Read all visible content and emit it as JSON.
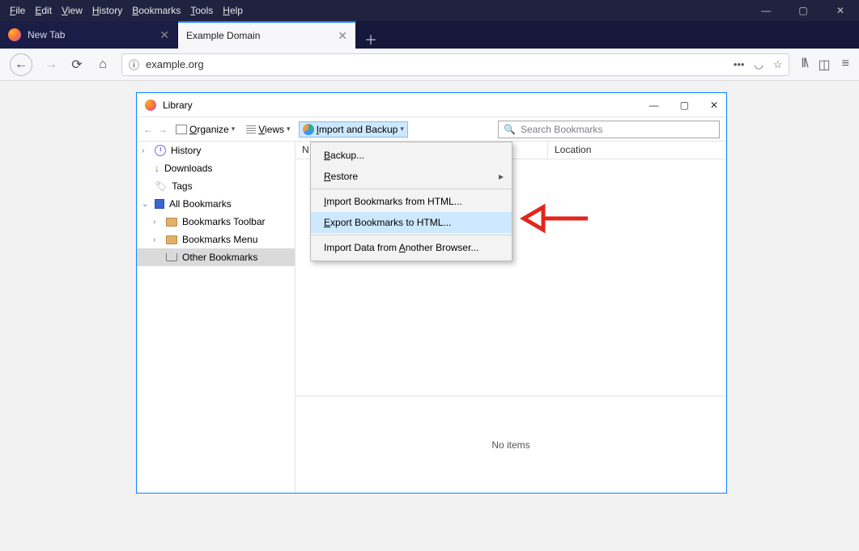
{
  "menubar": [
    "File",
    "Edit",
    "View",
    "History",
    "Bookmarks",
    "Tools",
    "Help"
  ],
  "tabs": {
    "inactive": "New Tab",
    "active": "Example Domain"
  },
  "address": "example.org",
  "library": {
    "title": "Library",
    "toolbar": {
      "organize": "Organize",
      "views": "Views",
      "import_backup": "Import and Backup"
    },
    "search_placeholder": "Search Bookmarks",
    "sidebar": {
      "history": "History",
      "downloads": "Downloads",
      "tags": "Tags",
      "all_bookmarks": "All Bookmarks",
      "bm_toolbar": "Bookmarks Toolbar",
      "bm_menu": "Bookmarks Menu",
      "other_bm": "Other Bookmarks"
    },
    "columns": {
      "name": "N",
      "location": "Location"
    },
    "footer": "No items",
    "dropdown": {
      "backup": "Backup...",
      "restore": "Restore",
      "import_html": "Import Bookmarks from HTML...",
      "export_html": "Export Bookmarks to HTML...",
      "import_other": "Import Data from Another Browser..."
    }
  }
}
